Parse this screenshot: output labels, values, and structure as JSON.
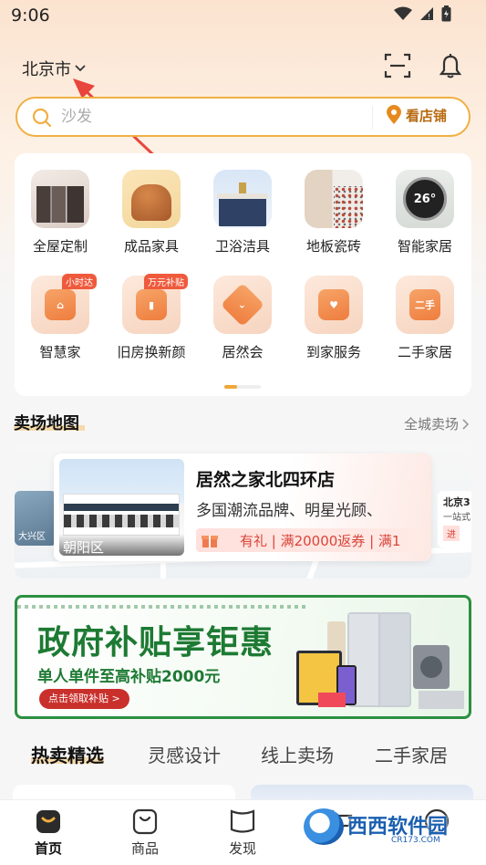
{
  "status_bar": {
    "time": "9:06"
  },
  "header": {
    "city": "北京市"
  },
  "search": {
    "placeholder": "沙发",
    "store_button": "看店铺"
  },
  "categories": [
    {
      "label": "全屋定制",
      "icon": "custom-home-icon"
    },
    {
      "label": "成品家具",
      "icon": "sofa-chair-icon"
    },
    {
      "label": "卫浴洁具",
      "icon": "bathroom-icon"
    },
    {
      "label": "地板瓷砖",
      "icon": "floor-tile-icon"
    },
    {
      "label": "智能家居",
      "icon": "smart-home-icon",
      "badge_text": "26°"
    },
    {
      "label": "智慧家",
      "icon": "smart-house-icon",
      "tag": "小时达"
    },
    {
      "label": "旧房换新颜",
      "icon": "paint-roller-icon",
      "tag": "万元补贴"
    },
    {
      "label": "居然会",
      "icon": "member-badge-icon"
    },
    {
      "label": "到家服务",
      "icon": "home-service-icon"
    },
    {
      "label": "二手家居",
      "icon": "second-hand-icon",
      "badge_text": "二手"
    }
  ],
  "market_map": {
    "title": "卖场地图",
    "more": "全城卖场",
    "left_card": {
      "district": "大兴区"
    },
    "right_card": {
      "name": "北京3",
      "line1": "一站式",
      "line2": "进"
    },
    "store": {
      "name": "居然之家北四环店",
      "district": "朝阳区",
      "description": "多国潮流品牌、明星光顾、",
      "promo": "有礼 | 满20000返券 | 满1"
    }
  },
  "banner": {
    "title": "政府补贴享钜惠",
    "subtitle": "单人单件至高补贴2000元",
    "cta": "点击领取补贴 >"
  },
  "feed_tabs": [
    {
      "label": "热卖精选",
      "active": true
    },
    {
      "label": "灵感设计",
      "active": false
    },
    {
      "label": "线上卖场",
      "active": false
    },
    {
      "label": "二手家居",
      "active": false
    }
  ],
  "bottom_nav": [
    {
      "label": "首页",
      "icon": "home-icon",
      "active": true
    },
    {
      "label": "商品",
      "icon": "shopping-bag-icon",
      "active": false
    },
    {
      "label": "发现",
      "icon": "discover-icon",
      "active": false
    },
    {
      "label": "",
      "icon": "cart-icon",
      "active": false
    },
    {
      "label": "",
      "icon": "profile-icon",
      "active": false
    }
  ],
  "watermark": {
    "text": "西西软件园",
    "sub": "CR173.COM"
  },
  "colors": {
    "accent": "#f0b043",
    "brand_green": "#1d7a33",
    "promo_red": "#d9443a"
  }
}
